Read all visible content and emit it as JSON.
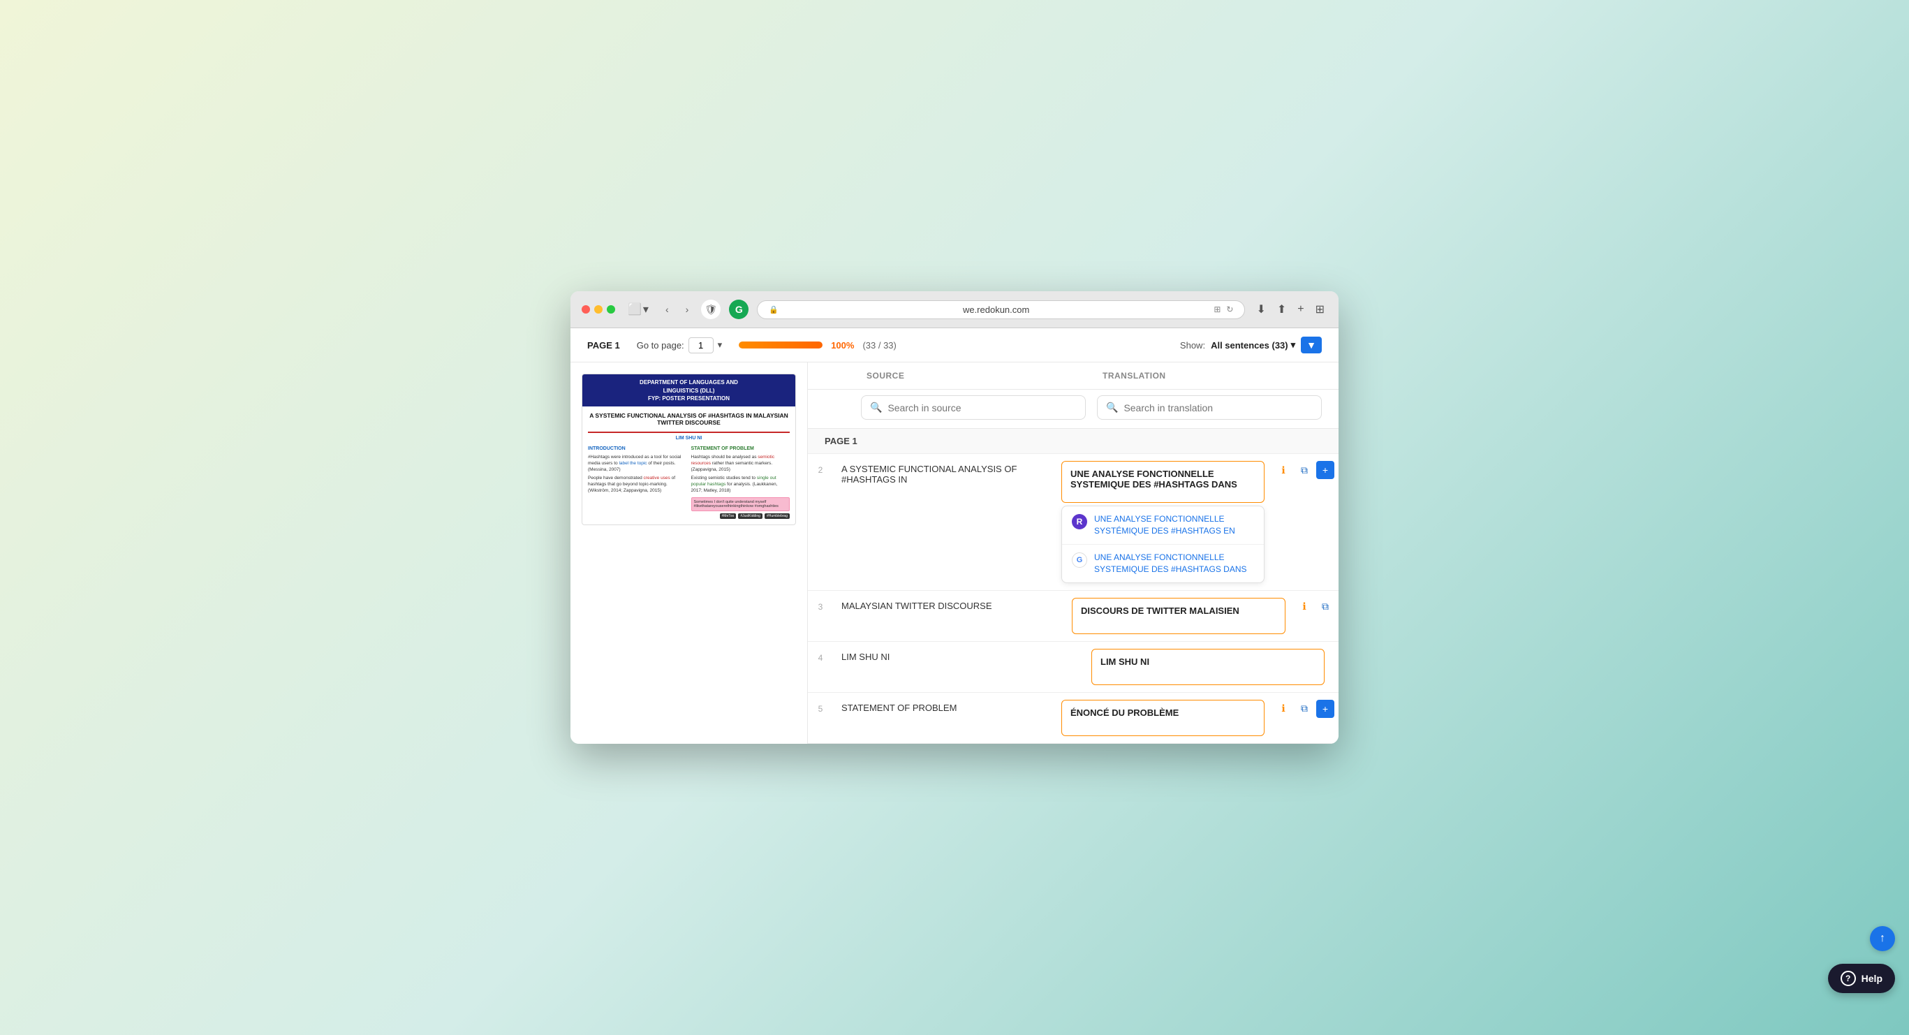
{
  "browser": {
    "url": "we.redokun.com",
    "traffic_lights": [
      "red",
      "yellow",
      "green"
    ],
    "back_btn": "‹",
    "forward_btn": "›",
    "shield_label": "🛡",
    "grammarly_label": "G",
    "download_icon": "⬇",
    "share_icon": "⬆",
    "add_tab_icon": "+",
    "grid_icon": "⊞"
  },
  "topbar": {
    "page_label": "PAGE 1",
    "goto_label": "Go to page:",
    "page_num": "1",
    "progress_pct": "100%",
    "progress_bar_width": "100",
    "progress_count": "(33 / 33)",
    "show_label": "Show:",
    "show_value": "All sentences (33)",
    "filter_icon": "▼"
  },
  "left_panel": {
    "preview_header_line1": "DEPARTMENT OF LANGUAGES AND",
    "preview_header_line2": "LINGUISTICS (DLL)",
    "preview_header_line3": "FYP: POSTER PRESENTATION",
    "preview_title": "A SYSTEMIC FUNCTIONAL ANALYSIS OF #HASHTAGS IN MALAYSIAN TWITTER DISCOURSE",
    "preview_author": "LIM SHU NI",
    "col1_title": "INTRODUCTION",
    "col2_title": "STATEMENT OF PROBLEM",
    "col1_text1": "#Hashtags were introduced as a tool for social media users to label the topic of their posts. (Messina, 2007)",
    "col1_text2": "People have demonstrated creative uses of hashtags that go beyond topic-marking. (Wikström, 2014; Zappavigna, 2015)",
    "col2_text1": "Hashtags should be analysed as semiotic resources rather than semantic markers. (Zappavigna, 2015)",
    "col2_text2": "Existing semiotic studies tend to single out popular hashtags for analysis. (Laukkanen, 2017; Matley, 2018)",
    "pink_box_text": "Sometimes I don't quite understand myself #likethatareyouserethinkingthinkow #omghashties",
    "social_badges": [
      "#MeToo",
      "#JustKidding",
      "#Humblebrag"
    ]
  },
  "right_panel": {
    "source_label": "SOURCE",
    "translation_label": "TRANSLATION",
    "search_source_placeholder": "Search in source",
    "search_translation_placeholder": "Search in translation",
    "page_section_label": "PAGE 1",
    "rows": [
      {
        "num": "2",
        "source": "A SYSTEMIC FUNCTIONAL ANALYSIS OF #HASHTAGS IN",
        "translation": "UNE ANALYSE FONCTIONNELLE SYSTEMIQUE DES #HASHTAGS DANS",
        "has_suggestions": true,
        "suggestions": [
          {
            "type": "purple",
            "icon_text": "R",
            "text": "UNE ANALYSE FONCTIONNELLE SYSTÉMIQUE DES #HASHTAGS EN"
          },
          {
            "type": "google",
            "icon_text": "G",
            "text": "UNE ANALYSE FONCTIONNELLE SYSTEMIQUE DES #HASHTAGS DANS"
          }
        ]
      },
      {
        "num": "3",
        "source": "MALAYSIAN TWITTER DISCOURSE",
        "translation": "DISCOURS DE TWITTER MALAISIEN",
        "has_suggestions": false,
        "suggestions": []
      },
      {
        "num": "4",
        "source": "LIM SHU NI",
        "translation": "LIM SHU NI",
        "has_suggestions": false,
        "suggestions": []
      },
      {
        "num": "5",
        "source": "STATEMENT OF PROBLEM",
        "translation": "ÉNONCÉ DU PROBLÈME",
        "has_suggestions": false,
        "suggestions": []
      }
    ]
  },
  "help_btn_label": "Help"
}
